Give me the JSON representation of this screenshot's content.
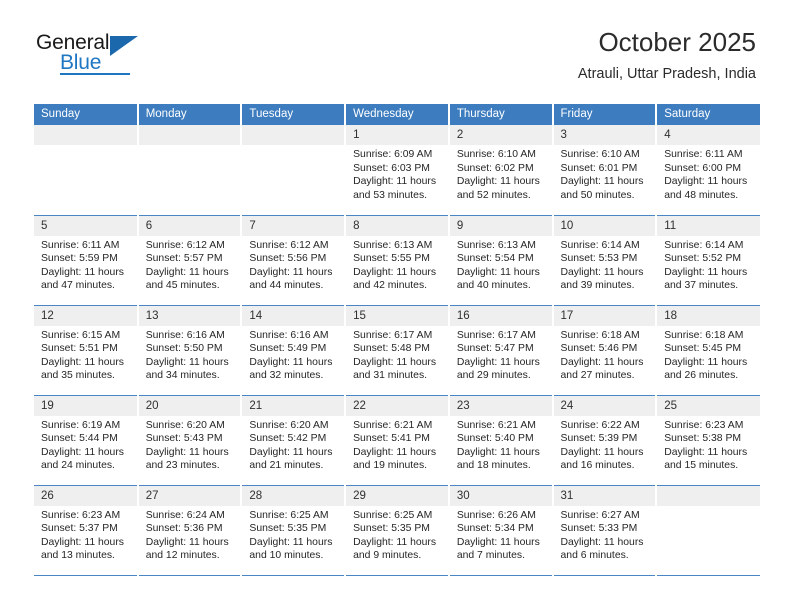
{
  "logo": {
    "line1": "General",
    "line2": "Blue",
    "triangle_color": "#1b68ac",
    "blue_color": "#1f77c4"
  },
  "header": {
    "title": "October 2025",
    "subtitle": "Atrauli, Uttar Pradesh, India"
  },
  "theme": {
    "header_bar": "#3c7cbf",
    "row_divider": "#4a86c5",
    "daynum_band": "#efefef",
    "text": "#262626"
  },
  "weekdays": [
    "Sunday",
    "Monday",
    "Tuesday",
    "Wednesday",
    "Thursday",
    "Friday",
    "Saturday"
  ],
  "labels": {
    "sunrise_prefix": "Sunrise: ",
    "sunset_prefix": "Sunset: ",
    "daylight_prefix": "Daylight: "
  },
  "weeks": [
    [
      {
        "day": "",
        "empty": true
      },
      {
        "day": "",
        "empty": true
      },
      {
        "day": "",
        "empty": true
      },
      {
        "day": "1",
        "sunrise": "Sunrise: 6:09 AM",
        "sunset": "Sunset: 6:03 PM",
        "daylight": "Daylight: 11 hours and 53 minutes."
      },
      {
        "day": "2",
        "sunrise": "Sunrise: 6:10 AM",
        "sunset": "Sunset: 6:02 PM",
        "daylight": "Daylight: 11 hours and 52 minutes."
      },
      {
        "day": "3",
        "sunrise": "Sunrise: 6:10 AM",
        "sunset": "Sunset: 6:01 PM",
        "daylight": "Daylight: 11 hours and 50 minutes."
      },
      {
        "day": "4",
        "sunrise": "Sunrise: 6:11 AM",
        "sunset": "Sunset: 6:00 PM",
        "daylight": "Daylight: 11 hours and 48 minutes."
      }
    ],
    [
      {
        "day": "5",
        "sunrise": "Sunrise: 6:11 AM",
        "sunset": "Sunset: 5:59 PM",
        "daylight": "Daylight: 11 hours and 47 minutes."
      },
      {
        "day": "6",
        "sunrise": "Sunrise: 6:12 AM",
        "sunset": "Sunset: 5:57 PM",
        "daylight": "Daylight: 11 hours and 45 minutes."
      },
      {
        "day": "7",
        "sunrise": "Sunrise: 6:12 AM",
        "sunset": "Sunset: 5:56 PM",
        "daylight": "Daylight: 11 hours and 44 minutes."
      },
      {
        "day": "8",
        "sunrise": "Sunrise: 6:13 AM",
        "sunset": "Sunset: 5:55 PM",
        "daylight": "Daylight: 11 hours and 42 minutes."
      },
      {
        "day": "9",
        "sunrise": "Sunrise: 6:13 AM",
        "sunset": "Sunset: 5:54 PM",
        "daylight": "Daylight: 11 hours and 40 minutes."
      },
      {
        "day": "10",
        "sunrise": "Sunrise: 6:14 AM",
        "sunset": "Sunset: 5:53 PM",
        "daylight": "Daylight: 11 hours and 39 minutes."
      },
      {
        "day": "11",
        "sunrise": "Sunrise: 6:14 AM",
        "sunset": "Sunset: 5:52 PM",
        "daylight": "Daylight: 11 hours and 37 minutes."
      }
    ],
    [
      {
        "day": "12",
        "sunrise": "Sunrise: 6:15 AM",
        "sunset": "Sunset: 5:51 PM",
        "daylight": "Daylight: 11 hours and 35 minutes."
      },
      {
        "day": "13",
        "sunrise": "Sunrise: 6:16 AM",
        "sunset": "Sunset: 5:50 PM",
        "daylight": "Daylight: 11 hours and 34 minutes."
      },
      {
        "day": "14",
        "sunrise": "Sunrise: 6:16 AM",
        "sunset": "Sunset: 5:49 PM",
        "daylight": "Daylight: 11 hours and 32 minutes."
      },
      {
        "day": "15",
        "sunrise": "Sunrise: 6:17 AM",
        "sunset": "Sunset: 5:48 PM",
        "daylight": "Daylight: 11 hours and 31 minutes."
      },
      {
        "day": "16",
        "sunrise": "Sunrise: 6:17 AM",
        "sunset": "Sunset: 5:47 PM",
        "daylight": "Daylight: 11 hours and 29 minutes."
      },
      {
        "day": "17",
        "sunrise": "Sunrise: 6:18 AM",
        "sunset": "Sunset: 5:46 PM",
        "daylight": "Daylight: 11 hours and 27 minutes."
      },
      {
        "day": "18",
        "sunrise": "Sunrise: 6:18 AM",
        "sunset": "Sunset: 5:45 PM",
        "daylight": "Daylight: 11 hours and 26 minutes."
      }
    ],
    [
      {
        "day": "19",
        "sunrise": "Sunrise: 6:19 AM",
        "sunset": "Sunset: 5:44 PM",
        "daylight": "Daylight: 11 hours and 24 minutes."
      },
      {
        "day": "20",
        "sunrise": "Sunrise: 6:20 AM",
        "sunset": "Sunset: 5:43 PM",
        "daylight": "Daylight: 11 hours and 23 minutes."
      },
      {
        "day": "21",
        "sunrise": "Sunrise: 6:20 AM",
        "sunset": "Sunset: 5:42 PM",
        "daylight": "Daylight: 11 hours and 21 minutes."
      },
      {
        "day": "22",
        "sunrise": "Sunrise: 6:21 AM",
        "sunset": "Sunset: 5:41 PM",
        "daylight": "Daylight: 11 hours and 19 minutes."
      },
      {
        "day": "23",
        "sunrise": "Sunrise: 6:21 AM",
        "sunset": "Sunset: 5:40 PM",
        "daylight": "Daylight: 11 hours and 18 minutes."
      },
      {
        "day": "24",
        "sunrise": "Sunrise: 6:22 AM",
        "sunset": "Sunset: 5:39 PM",
        "daylight": "Daylight: 11 hours and 16 minutes."
      },
      {
        "day": "25",
        "sunrise": "Sunrise: 6:23 AM",
        "sunset": "Sunset: 5:38 PM",
        "daylight": "Daylight: 11 hours and 15 minutes."
      }
    ],
    [
      {
        "day": "26",
        "sunrise": "Sunrise: 6:23 AM",
        "sunset": "Sunset: 5:37 PM",
        "daylight": "Daylight: 11 hours and 13 minutes."
      },
      {
        "day": "27",
        "sunrise": "Sunrise: 6:24 AM",
        "sunset": "Sunset: 5:36 PM",
        "daylight": "Daylight: 11 hours and 12 minutes."
      },
      {
        "day": "28",
        "sunrise": "Sunrise: 6:25 AM",
        "sunset": "Sunset: 5:35 PM",
        "daylight": "Daylight: 11 hours and 10 minutes."
      },
      {
        "day": "29",
        "sunrise": "Sunrise: 6:25 AM",
        "sunset": "Sunset: 5:35 PM",
        "daylight": "Daylight: 11 hours and 9 minutes."
      },
      {
        "day": "30",
        "sunrise": "Sunrise: 6:26 AM",
        "sunset": "Sunset: 5:34 PM",
        "daylight": "Daylight: 11 hours and 7 minutes."
      },
      {
        "day": "31",
        "sunrise": "Sunrise: 6:27 AM",
        "sunset": "Sunset: 5:33 PM",
        "daylight": "Daylight: 11 hours and 6 minutes."
      },
      {
        "day": "",
        "empty": true
      }
    ]
  ]
}
